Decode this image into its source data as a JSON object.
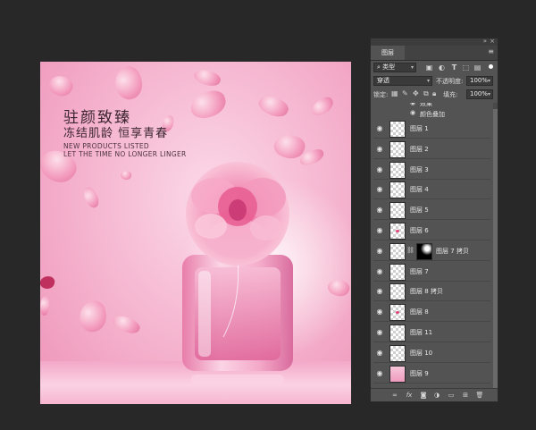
{
  "canvas": {
    "title_cn": "驻颜致臻",
    "subtitle_cn": "冻结肌龄 恒享青春",
    "en_line1": "NEW PRODUCTS LISTED",
    "en_line2": "LET THE TIME NO LONGER LINGER"
  },
  "panel": {
    "tab_label": "图层",
    "topbar_icons": {
      "collapse": "collapse-icon",
      "close": "close-icon"
    },
    "menu_icon": "panel-menu-icon",
    "filter": {
      "kind_label": "类型",
      "icons": [
        "image-filter-icon",
        "adjustment-filter-icon",
        "type-filter-icon",
        "shape-filter-icon",
        "smart-object-filter-icon"
      ]
    },
    "blend_mode": "穿透",
    "opacity_label": "不透明度:",
    "opacity_value": "100%",
    "lock_label": "锁定:",
    "fill_label": "填充:",
    "fill_value": "100%",
    "effects_header": "效果",
    "effect_color_overlay": "颜色叠加",
    "layers": [
      {
        "name": "图层 1",
        "thumb": "transparent"
      },
      {
        "name": "图层 2",
        "thumb": "transparent"
      },
      {
        "name": "图层 3",
        "thumb": "transparent"
      },
      {
        "name": "图层 4",
        "thumb": "transparent"
      },
      {
        "name": "图层 5",
        "thumb": "transparent"
      },
      {
        "name": "图层 6",
        "thumb": "petal"
      },
      {
        "name": "图层 7 拷贝",
        "thumb": "transparent",
        "mask": true
      },
      {
        "name": "图层 7",
        "thumb": "transparent"
      },
      {
        "name": "图层 8 拷贝",
        "thumb": "transparent"
      },
      {
        "name": "图层 8",
        "thumb": "petal"
      },
      {
        "name": "图层 11",
        "thumb": "transparent"
      },
      {
        "name": "图层 10",
        "thumb": "transparent"
      },
      {
        "name": "图层 9",
        "thumb": "pink"
      }
    ],
    "footer_icons": [
      "link-layers-icon",
      "fx-icon",
      "add-mask-icon",
      "adjustment-layer-icon",
      "new-group-icon",
      "new-layer-icon",
      "delete-layer-icon"
    ]
  },
  "colors": {
    "workspace_bg": "#282828",
    "panel_bg": "#535353",
    "accent_pink": "#ee93b7"
  }
}
